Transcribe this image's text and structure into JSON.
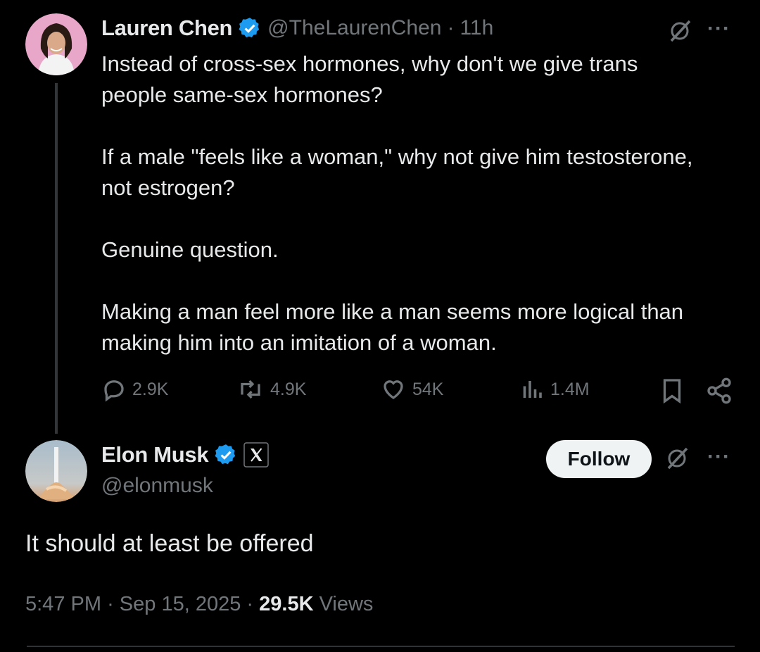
{
  "original_tweet": {
    "author_name": "Lauren Chen",
    "handle": "@TheLaurenChen",
    "separator": "·",
    "time": "11h",
    "lines": [
      "Instead of cross-sex hormones, why don't we give trans",
      "people same-sex hormones?",
      "If a male \"feels like a woman,\" why not give him testosterone,",
      "not estrogen?",
      "Genuine question.",
      "Making a man feel more like a man seems more logical than",
      "making him into an imitation of a woman."
    ],
    "stats": {
      "replies": "2.9K",
      "reposts": "4.9K",
      "likes": "54K",
      "views": "1.4M"
    },
    "more": "···"
  },
  "reply_tweet": {
    "author_name": "Elon Musk",
    "handle": "@elonmusk",
    "follow_label": "Follow",
    "text": "It should at least be offered",
    "time": "5:47 PM",
    "sep1": "·",
    "date": "Sep 15, 2025",
    "sep2": "·",
    "view_count": "29.5K",
    "views_label": "Views",
    "more": "···"
  },
  "colors": {
    "background": "#000000",
    "text": "#e7e9ea",
    "muted": "#71767b",
    "verified": "#1d9bf0",
    "thread_line": "#333639",
    "follow_bg": "#eff3f4"
  },
  "icons": [
    "verified-badge-icon",
    "grok-icon",
    "more-icon",
    "reply-icon",
    "repost-icon",
    "like-icon",
    "views-icon",
    "bookmark-icon",
    "share-icon",
    "x-logo-icon"
  ]
}
